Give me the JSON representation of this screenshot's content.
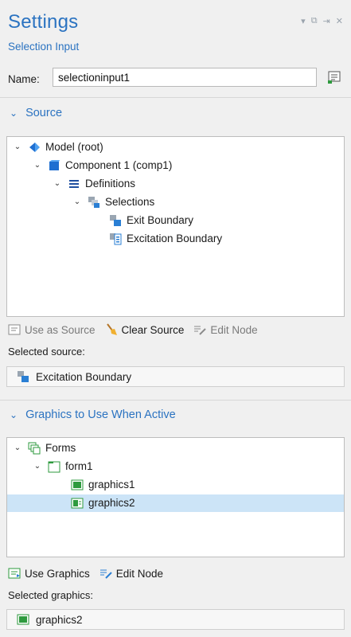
{
  "header": {
    "title": "Settings",
    "subtitle": "Selection Input",
    "window_controls": [
      "▾",
      "⧉",
      "⇥",
      "✕"
    ]
  },
  "name_row": {
    "label": "Name:",
    "value": "selectioninput1"
  },
  "source": {
    "title": "Source",
    "tree": [
      {
        "label": "Model (root)",
        "icon": "model-icon",
        "expanded": true
      },
      {
        "label": "Component 1 (comp1)",
        "icon": "component-icon",
        "expanded": true
      },
      {
        "label": "Definitions",
        "icon": "definitions-icon",
        "expanded": true
      },
      {
        "label": "Selections",
        "icon": "selections-icon",
        "expanded": true
      },
      {
        "label": "Exit Boundary",
        "icon": "boundary-selection-icon"
      },
      {
        "label": "Excitation Boundary",
        "icon": "boundary-selection-icon"
      }
    ],
    "toolbar": {
      "use_as_source": "Use as Source",
      "clear_source": "Clear Source",
      "edit_node": "Edit Node"
    },
    "selected_label": "Selected source:",
    "selected_value": "Excitation Boundary"
  },
  "graphics": {
    "title": "Graphics to Use When Active",
    "tree": [
      {
        "label": "Forms",
        "icon": "forms-icon",
        "expanded": true
      },
      {
        "label": "form1",
        "icon": "form-folder-icon",
        "expanded": true
      },
      {
        "label": "graphics1",
        "icon": "graphics-icon"
      },
      {
        "label": "graphics2",
        "icon": "graphics-icon",
        "selected": true
      }
    ],
    "toolbar": {
      "use_graphics": "Use Graphics",
      "edit_node": "Edit Node"
    },
    "selected_label": "Selected graphics:",
    "selected_value": "graphics2"
  },
  "colors": {
    "accent": "#2b73c1",
    "selection": "#cce4f7"
  }
}
